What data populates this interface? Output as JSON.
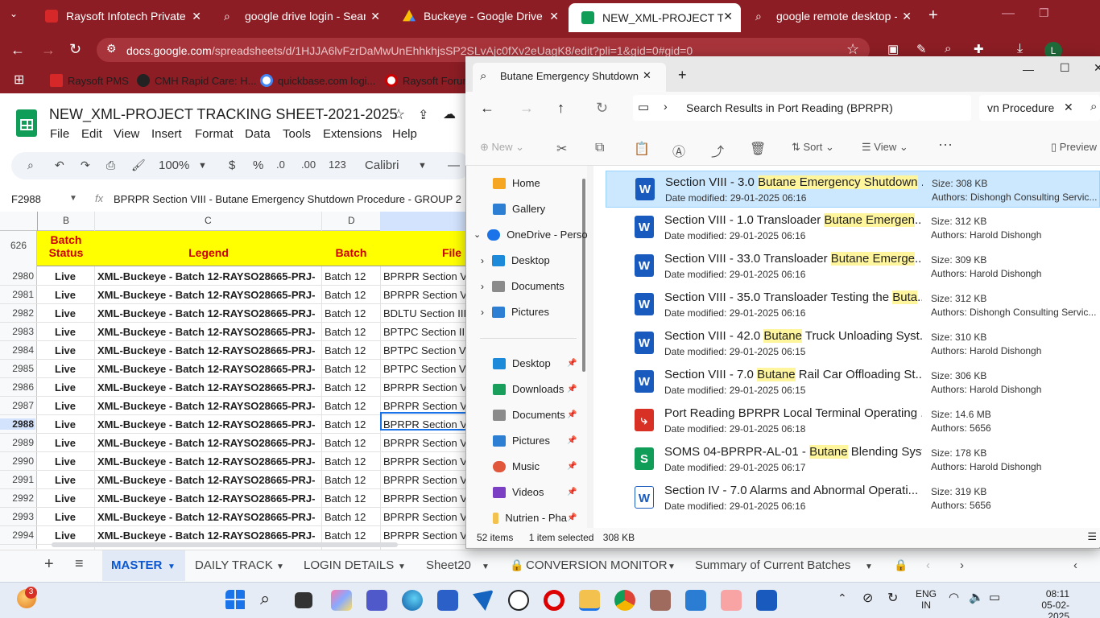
{
  "browser": {
    "tabs": [
      {
        "title": "Raysoft Infotech Private Limi",
        "icon": "raysoft-icon"
      },
      {
        "title": "google drive login - Search",
        "icon": "search-icon"
      },
      {
        "title": "Buckeye - Google Drive",
        "icon": "drive-icon"
      },
      {
        "title": "NEW_XML-PROJECT TRACKI",
        "icon": "sheets-icon"
      },
      {
        "title": "google remote desktop - Se",
        "icon": "search-icon"
      }
    ],
    "url_host": "docs.google.com",
    "url_path": "/spreadsheets/d/1HJJA6lvFzrDaMwUnEhhkhjsSP2SLvAjc0fXv2eUagK8/edit?pli=1&gid=0#gid=0",
    "bookmarks": [
      "Raysoft PMS",
      "CMH Rapid Care: H...",
      "quickbase.com logi...",
      "Raysoft Forum"
    ],
    "profile_letter": "L"
  },
  "sheet": {
    "title": "NEW_XML-PROJECT TRACKING SHEET-2021-2025",
    "menus": [
      "File",
      "Edit",
      "View",
      "Insert",
      "Format",
      "Data",
      "Tools",
      "Extensions",
      "Help"
    ],
    "zoom": "100%",
    "currency": "$",
    "percent": "%",
    "dec_less": ".0",
    "dec_more": ".00",
    "num_format": "123",
    "font": "Calibri",
    "name_box": "F2988",
    "formula": "BPRPR Section VIII - Butane Emergency Shutdown Procedure - GROUP 2",
    "col_letters": [
      "B",
      "C",
      "D"
    ],
    "frozen_count": "626",
    "headers": {
      "batch_status": "Batch Status",
      "legend": "Legend",
      "batch": "Batch",
      "file": "File"
    },
    "rows": [
      {
        "n": "2980",
        "b": "Live",
        "c": "XML-Buckeye - Batch 12-RAYSO28665-PRJ-",
        "d": "Batch 12",
        "f": "BPRPR Section VI"
      },
      {
        "n": "2981",
        "b": "Live",
        "c": "XML-Buckeye - Batch 12-RAYSO28665-PRJ-",
        "d": "Batch 12",
        "f": "BPRPR Section VI"
      },
      {
        "n": "2982",
        "b": "Live",
        "c": "XML-Buckeye - Batch 12-RAYSO28665-PRJ-",
        "d": "Batch 12",
        "f": "BDLTU Section III"
      },
      {
        "n": "2983",
        "b": "Live",
        "c": "XML-Buckeye - Batch 12-RAYSO28665-PRJ-",
        "d": "Batch 12",
        "f": "BPTPC Section III"
      },
      {
        "n": "2984",
        "b": "Live",
        "c": "XML-Buckeye - Batch 12-RAYSO28665-PRJ-",
        "d": "Batch 12",
        "f": "BPTPC Section VI"
      },
      {
        "n": "2985",
        "b": "Live",
        "c": "XML-Buckeye - Batch 12-RAYSO28665-PRJ-",
        "d": "Batch 12",
        "f": "BPTPC Section VI"
      },
      {
        "n": "2986",
        "b": "Live",
        "c": "XML-Buckeye - Batch 12-RAYSO28665-PRJ-",
        "d": "Batch 12",
        "f": "BPRPR Section VI"
      },
      {
        "n": "2987",
        "b": "Live",
        "c": "XML-Buckeye - Batch 12-RAYSO28665-PRJ-",
        "d": "Batch 12",
        "f": "BPRPR Section VI"
      },
      {
        "n": "2988",
        "b": "Live",
        "c": "XML-Buckeye - Batch 12-RAYSO28665-PRJ-",
        "d": "Batch 12",
        "f": "BPRPR Section VI"
      },
      {
        "n": "2989",
        "b": "Live",
        "c": "XML-Buckeye - Batch 12-RAYSO28665-PRJ-",
        "d": "Batch 12",
        "f": "BPRPR Section VI"
      },
      {
        "n": "2990",
        "b": "Live",
        "c": "XML-Buckeye - Batch 12-RAYSO28665-PRJ-",
        "d": "Batch 12",
        "f": "BPRPR Section VI"
      },
      {
        "n": "2991",
        "b": "Live",
        "c": "XML-Buckeye - Batch 12-RAYSO28665-PRJ-",
        "d": "Batch 12",
        "f": "BPRPR Section VI"
      },
      {
        "n": "2992",
        "b": "Live",
        "c": "XML-Buckeye - Batch 12-RAYSO28665-PRJ-",
        "d": "Batch 12",
        "f": "BPRPR Section VI"
      },
      {
        "n": "2993",
        "b": "Live",
        "c": "XML-Buckeye - Batch 12-RAYSO28665-PRJ-",
        "d": "Batch 12",
        "f": "BPRPR Section VI"
      },
      {
        "n": "2994",
        "b": "Live",
        "c": "XML-Buckeye - Batch 12-RAYSO28665-PRJ-",
        "d": "Batch 12",
        "f": "BPRPR Section VI"
      }
    ],
    "sheet_tabs": [
      "MASTER",
      "DAILY TRACK",
      "LOGIN DETAILS",
      "Sheet20",
      "CONVERSION MONITOR",
      "Summary of Current Batches"
    ]
  },
  "explorer": {
    "tab_title": "Butane Emergency Shutdown",
    "path": "Search Results in Port Reading (BPRPR)",
    "search_value": "vn Procedure",
    "commands": {
      "new": "New",
      "sort": "Sort",
      "view": "View",
      "preview": "Preview"
    },
    "sidebar": {
      "top": [
        "Home",
        "Gallery",
        "OneDrive - Perso"
      ],
      "onedrive": [
        "Desktop",
        "Documents",
        "Pictures"
      ],
      "quick": [
        "Desktop",
        "Downloads",
        "Documents",
        "Pictures",
        "Music",
        "Videos",
        "Nutrien - Pha"
      ]
    },
    "items": [
      {
        "pre": "Section VIII - 3.0 ",
        "hl": "Butane Emergency Shutdown",
        "post": " ...",
        "date": "Date modified: 29-01-2025 06:16",
        "size": "Size: 308 KB",
        "authors": "Authors: Dishongh Consulting Servic...",
        "type": "word"
      },
      {
        "pre": "Section VIII - 1.0  Transloader ",
        "hl": "Butane Emergen",
        "post": "...",
        "date": "Date modified: 29-01-2025 06:16",
        "size": "Size: 312 KB",
        "authors": "Authors: Harold Dishongh",
        "type": "word"
      },
      {
        "pre": "Section VIII - 33.0 Transloader ",
        "hl": "Butane Emerge",
        "post": "...",
        "date": "Date modified: 29-01-2025 06:16",
        "size": "Size: 309 KB",
        "authors": "Authors: Harold Dishongh",
        "type": "word"
      },
      {
        "pre": "Section VIII - 35.0 Transloader Testing the ",
        "hl": "Buta",
        "post": "...",
        "date": "Date modified: 29-01-2025 06:16",
        "size": "Size: 312 KB",
        "authors": "Authors: Dishongh Consulting Servic...",
        "type": "word"
      },
      {
        "pre": "Section VIII - 42.0 ",
        "hl": "Butane",
        "post": " Truck Unloading Syst...",
        "date": "Date modified: 29-01-2025 06:15",
        "size": "Size: 310 KB",
        "authors": "Authors: Harold Dishongh",
        "type": "word"
      },
      {
        "pre": "Section VIII - 7.0 ",
        "hl": "Butane",
        "post": " Rail Car Offloading St...",
        "date": "Date modified: 29-01-2025 06:15",
        "size": "Size: 306 KB",
        "authors": "Authors: Harold Dishongh",
        "type": "word"
      },
      {
        "pre": "Port Reading BPRPR Local Terminal Operating ...",
        "hl": "",
        "post": "",
        "date": "Date modified: 29-01-2025 06:18",
        "size": "Size: 14.6 MB",
        "authors": "Authors: 5656",
        "type": "pdf"
      },
      {
        "pre": "SOMS 04-BPRPR-AL-01 - ",
        "hl": "Butane",
        "post": " Blending Syst...",
        "date": "Date modified: 29-01-2025 06:17",
        "size": "Size: 178 KB",
        "authors": "Authors: Harold Dishongh",
        "type": "sheet"
      },
      {
        "pre": "Section IV - 7.0 Alarms and Abnormal Operati...",
        "hl": "",
        "post": "",
        "date": "Date modified: 29-01-2025 06:16",
        "size": "Size: 319 KB",
        "authors": "Authors: 5656",
        "type": "word-outline"
      }
    ],
    "status": {
      "count": "52 items",
      "selected": "1 item selected",
      "size": "308 KB"
    }
  },
  "taskbar": {
    "notification_count": "3",
    "lang_top": "ENG",
    "lang_bottom": "IN",
    "time": "08:11",
    "date": "05-02-2025"
  },
  "colors": {
    "browser_frame": "#8c1d24",
    "header_yellow": "#ffff00",
    "header_text": "#cc0000",
    "selection_blue": "#cce8ff",
    "search_highlight": "#fff59d"
  }
}
